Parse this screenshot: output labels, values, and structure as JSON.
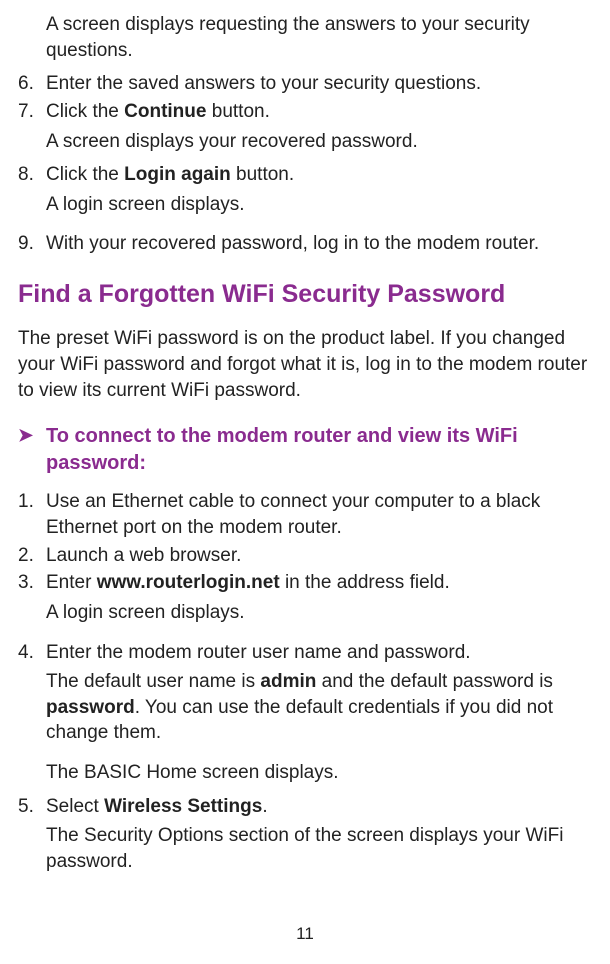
{
  "intro_para": "A screen displays requesting the answers to your security questions.",
  "list1": {
    "item6": {
      "num": "6.",
      "text": "Enter the saved answers to your security questions."
    },
    "item7": {
      "num": "7.",
      "text_pre": "Click the ",
      "bold": "Continue",
      "text_post": " button.",
      "after": "A screen displays your recovered password."
    },
    "item8": {
      "num": "8.",
      "text_pre": "Click the ",
      "bold": "Login again",
      "text_post": " button.",
      "after": "A login screen displays."
    },
    "item9": {
      "num": "9.",
      "text": "With your recovered password, log in to the modem router."
    }
  },
  "heading": "Find a Forgotten WiFi Security Password",
  "section_intro": "The preset WiFi password is on the product label. If you changed your WiFi password and forgot what it is, log in to the modem router to view its current WiFi password.",
  "task_arrow": "➤",
  "task_heading": "To connect to the modem router and view its WiFi password:",
  "list2": {
    "item1": {
      "num": "1.",
      "text": "Use an Ethernet cable to connect your computer to a black Ethernet port on the modem router."
    },
    "item2": {
      "num": "2.",
      "text": "Launch a web browser."
    },
    "item3": {
      "num": "3.",
      "text_pre": "Enter ",
      "bold": "www.routerlogin.net",
      "text_post": " in the address field.",
      "after": "A login screen displays."
    },
    "item4": {
      "num": "4.",
      "text": "Enter the modem router user name and password.",
      "after1_pre": "The default user name is ",
      "after1_b1": "admin",
      "after1_mid": " and the default password is ",
      "after1_b2": "password",
      "after1_post": ". You can use the default credentials if you did not change them.",
      "after2": "The BASIC Home screen displays."
    },
    "item5": {
      "num": "5.",
      "text_pre": "Select ",
      "bold": "Wireless Settings",
      "text_post": ".",
      "after": "The Security Options section of the screen displays your WiFi password."
    }
  },
  "page_number": "11"
}
